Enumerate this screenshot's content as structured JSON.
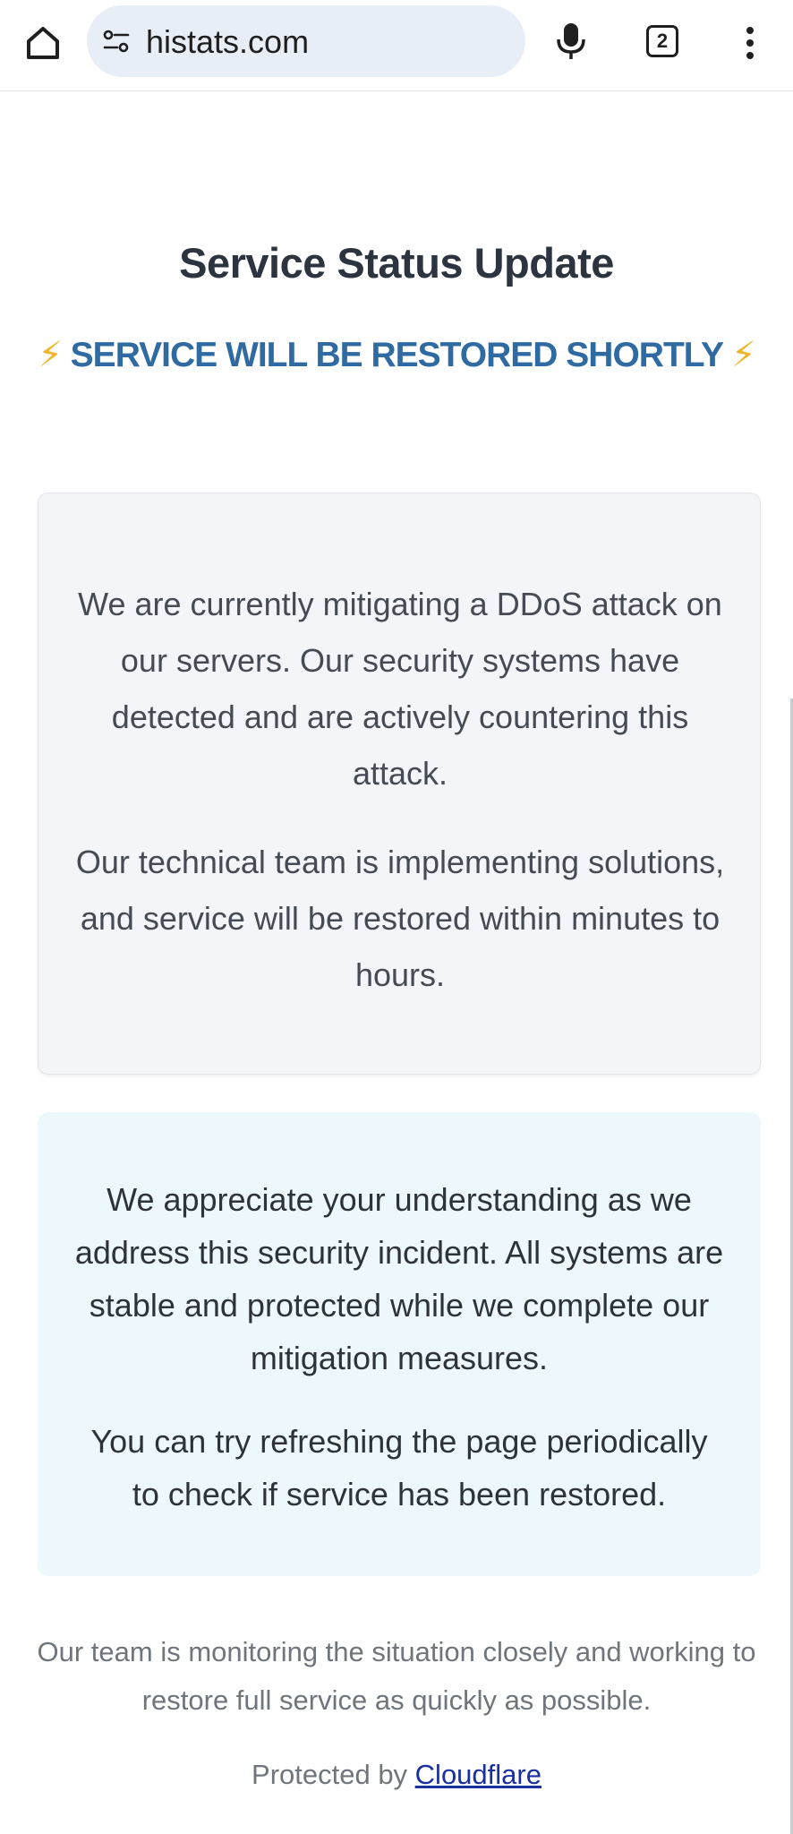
{
  "browser": {
    "url": "histats.com",
    "tab_count": "2",
    "icons": [
      "home-icon",
      "site-info-icon",
      "mic-icon",
      "tabs-icon",
      "more-vert-icon"
    ]
  },
  "page": {
    "title": "Service Status Update",
    "subtitle": "SERVICE WILL BE RESTORED SHORTLY",
    "bolt_glyph": "⚡",
    "card_primary": {
      "paragraph_1": "We are currently mitigating a DDoS attack on our servers. Our security systems have detected and are actively countering this attack.",
      "paragraph_2": "Our technical team is implementing solutions, and service will be restored within minutes to hours."
    },
    "card_secondary": {
      "paragraph_1": "We appreciate your understanding as we address this security incident. All systems are stable and protected while we complete our mitigation measures.",
      "paragraph_2": "You can try refreshing the page periodically to check if service has been restored."
    },
    "footer_note": "Our team is monitoring the situation closely and working to restore full service as quickly as possible.",
    "protected_prefix": "Protected by ",
    "protected_link": "Cloudflare"
  },
  "colors": {
    "subtitle": "#2f6aa2",
    "bolt": "#f0b429",
    "card_primary_bg": "#f4f5f9",
    "card_secondary_bg": "#edf8fd",
    "link": "#1a2fa0"
  }
}
